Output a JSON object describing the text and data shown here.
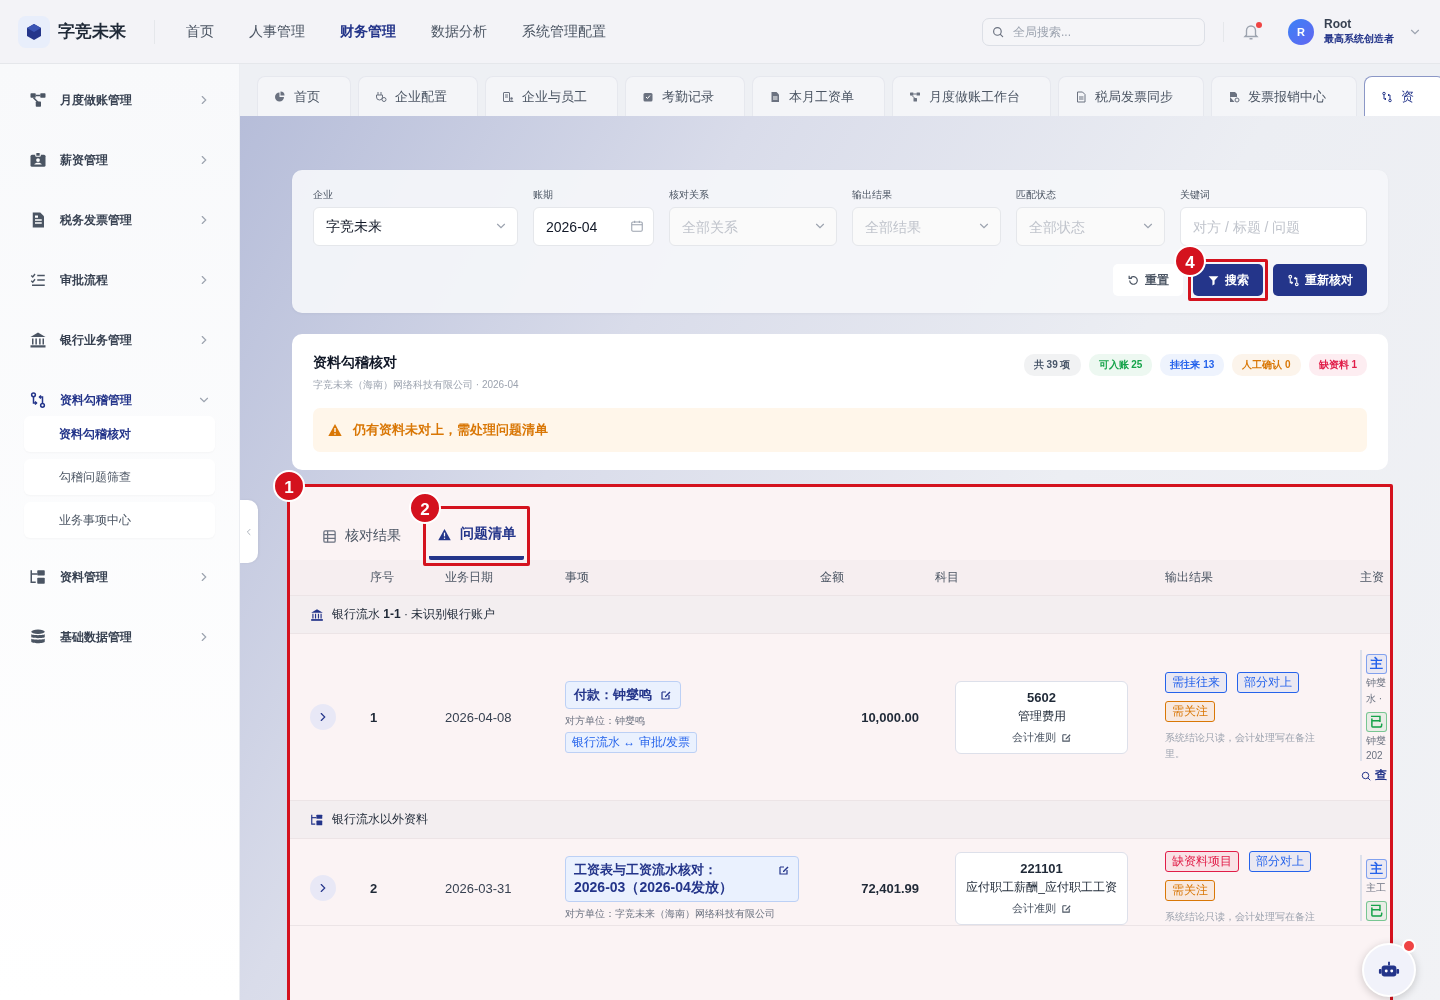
{
  "header": {
    "brand": "字竞未来",
    "nav": [
      {
        "label": "首页",
        "selected": false
      },
      {
        "label": "人事管理",
        "selected": false
      },
      {
        "label": "财务管理",
        "selected": true
      },
      {
        "label": "数据分析",
        "selected": false
      },
      {
        "label": "系统管理配置",
        "selected": false
      }
    ],
    "search": {
      "placeholder": "全局搜索..."
    },
    "notification_unread": true,
    "user": {
      "avatar": "R",
      "name": "Root",
      "role": "最高系统创造者"
    }
  },
  "sidebar": {
    "items": [
      {
        "label": "月度做账管理",
        "selected": false,
        "expanded": false
      },
      {
        "label": "薪资管理",
        "selected": false,
        "expanded": false
      },
      {
        "label": "税务发票管理",
        "selected": false,
        "expanded": false
      },
      {
        "label": "审批流程",
        "selected": false,
        "expanded": false
      },
      {
        "label": "银行业务管理",
        "selected": false,
        "expanded": false
      },
      {
        "label": "资料勾稽管理",
        "selected": true,
        "expanded": true,
        "children": [
          {
            "label": "资料勾稽核对",
            "selected": true
          },
          {
            "label": "勾稽问题筛查",
            "selected": false
          },
          {
            "label": "业务事项中心",
            "selected": false
          }
        ]
      },
      {
        "label": "资料管理",
        "selected": false,
        "expanded": false
      },
      {
        "label": "基础数据管理",
        "selected": false,
        "expanded": false
      }
    ]
  },
  "tabs": [
    {
      "label": "首页",
      "selected": false
    },
    {
      "label": "企业配置",
      "selected": false
    },
    {
      "label": "企业与员工",
      "selected": false
    },
    {
      "label": "考勤记录",
      "selected": false
    },
    {
      "label": "本月工资单",
      "selected": false
    },
    {
      "label": "月度做账工作台",
      "selected": false
    },
    {
      "label": "税局发票同步",
      "selected": false
    },
    {
      "label": "发票报销中心",
      "selected": false
    },
    {
      "label": "资",
      "selected": true
    }
  ],
  "filters": {
    "fields": [
      {
        "label": "企业",
        "kind": "select",
        "value": "字竞未来"
      },
      {
        "label": "账期",
        "kind": "date",
        "value": "2026-04"
      },
      {
        "label": "核对关系",
        "kind": "select",
        "placeholder": "全部关系"
      },
      {
        "label": "输出结果",
        "kind": "select",
        "placeholder": "全部结果"
      },
      {
        "label": "匹配状态",
        "kind": "select",
        "placeholder": "全部状态"
      },
      {
        "label": "关键词",
        "kind": "text",
        "placeholder": "对方 / 标题 / 问题"
      }
    ],
    "buttons": [
      {
        "label": "重置",
        "kind": "plain"
      },
      {
        "label": "搜索",
        "kind": "primary",
        "annotation": "4"
      },
      {
        "label": "重新核对",
        "kind": "primary"
      }
    ]
  },
  "summary": {
    "title": "资料勾稽核对",
    "subtitle": "字竞未来（海南）网络科技有限公司 · 2026-04",
    "badges": [
      {
        "label": "共 39 项",
        "color": "#475569"
      },
      {
        "label": "可入账 25",
        "color": "#16a34a"
      },
      {
        "label": "挂往来 13",
        "color": "#2563eb"
      },
      {
        "label": "人工确认 0",
        "color": "#d97706"
      },
      {
        "label": "缺资料 1",
        "color": "#e11d48"
      }
    ],
    "alert": "仍有资料未对上，需处理问题清单"
  },
  "issues": {
    "annotation": "1",
    "tabs": [
      {
        "label": "核对结果",
        "selected": false
      },
      {
        "label": "问题清单",
        "selected": true,
        "annotation": "2"
      }
    ],
    "columns": [
      "序号",
      "业务日期",
      "事项",
      "金额",
      "科目",
      "输出结果",
      "主资"
    ],
    "groups": [
      {
        "title": "银行流水 **1-1** · 未识别银行账户",
        "rows": [
          {
            "index": "1",
            "date": "2026-04-08",
            "item": {
              "title": "付款：钟燮鸣",
              "counterparty": "对方单位：钟燮鸣",
              "relation": "银行流水 ↔ 审批/发票"
            },
            "amount": "10,000.00",
            "account": {
              "code": "5602",
              "name": "管理费用",
              "rule": "会计准则"
            },
            "results": [
              {
                "label": "需挂往来",
                "color": "#2563eb"
              },
              {
                "label": "部分对上",
                "color": "#2563eb"
              },
              {
                "label": "需关注",
                "color": "#d97706"
              }
            ],
            "note": "系统结论只读，会计处理写在备注里。",
            "main_material": [
              {
                "label": "主",
                "kind": "tag",
                "color": "#2563eb"
              },
              {
                "label": "钟燮",
                "kind": "text"
              },
              {
                "label": "水 ·",
                "kind": "text"
              },
              {
                "label": "已",
                "kind": "tag",
                "color": "#16a34a"
              },
              {
                "label": "钟燮",
                "kind": "text"
              },
              {
                "label": "202",
                "kind": "text"
              }
            ],
            "link": "查"
          }
        ]
      },
      {
        "title": "银行流水以外资料",
        "rows": [
          {
            "index": "2",
            "date": "2026-03-31",
            "item": {
              "title": "工资表与工资流水核对：**2026-03（2026-04发放）**",
              "counterparty": "对方单位：字竞未来（海南）网络科技有限公司"
            },
            "amount": "72,401.99",
            "account": {
              "code": "221101",
              "name": "应付职工薪酬_应付职工工资",
              "rule": "会计准则"
            },
            "results": [
              {
                "label": "缺资料项目",
                "color": "#e11d48"
              },
              {
                "label": "部分对上",
                "color": "#2563eb"
              },
              {
                "label": "需关注",
                "color": "#d97706"
              }
            ],
            "note": "系统结论只读，会计处理写在备注",
            "main_material": [
              {
                "label": "主",
                "kind": "tag",
                "color": "#2563eb"
              },
              {
                "label": "主工",
                "kind": "text"
              },
              {
                "label": "已",
                "kind": "tag",
                "color": "#16a34a"
              }
            ]
          }
        ]
      }
    ]
  }
}
